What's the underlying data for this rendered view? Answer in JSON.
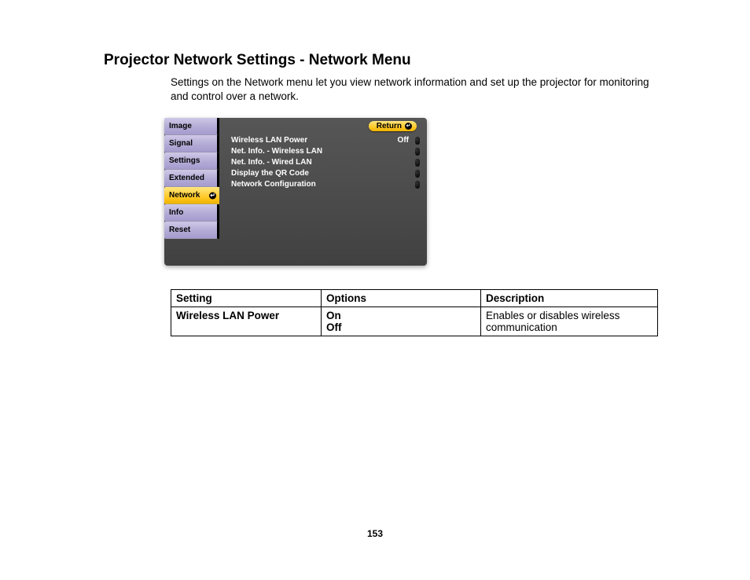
{
  "heading": "Projector Network Settings - Network Menu",
  "intro": "Settings on the Network menu let you view network information and set up the projector for monitoring and control over a network.",
  "osd": {
    "tabs": [
      "Image",
      "Signal",
      "Settings",
      "Extended",
      "Network",
      "Info",
      "Reset"
    ],
    "active_tab_index": 4,
    "return_label": "Return",
    "items": [
      {
        "label": "Wireless LAN Power",
        "value": "Off"
      },
      {
        "label": "Net. Info. - Wireless LAN",
        "value": ""
      },
      {
        "label": "Net. Info. - Wired LAN",
        "value": ""
      },
      {
        "label": "Display the QR Code",
        "value": ""
      },
      {
        "label": "Network Configuration",
        "value": ""
      }
    ]
  },
  "table": {
    "headers": [
      "Setting",
      "Options",
      "Description"
    ],
    "rows": [
      {
        "setting": "Wireless LAN Power",
        "options": [
          "On",
          "Off"
        ],
        "description": "Enables or disables wireless communication"
      }
    ]
  },
  "page_number": "153"
}
